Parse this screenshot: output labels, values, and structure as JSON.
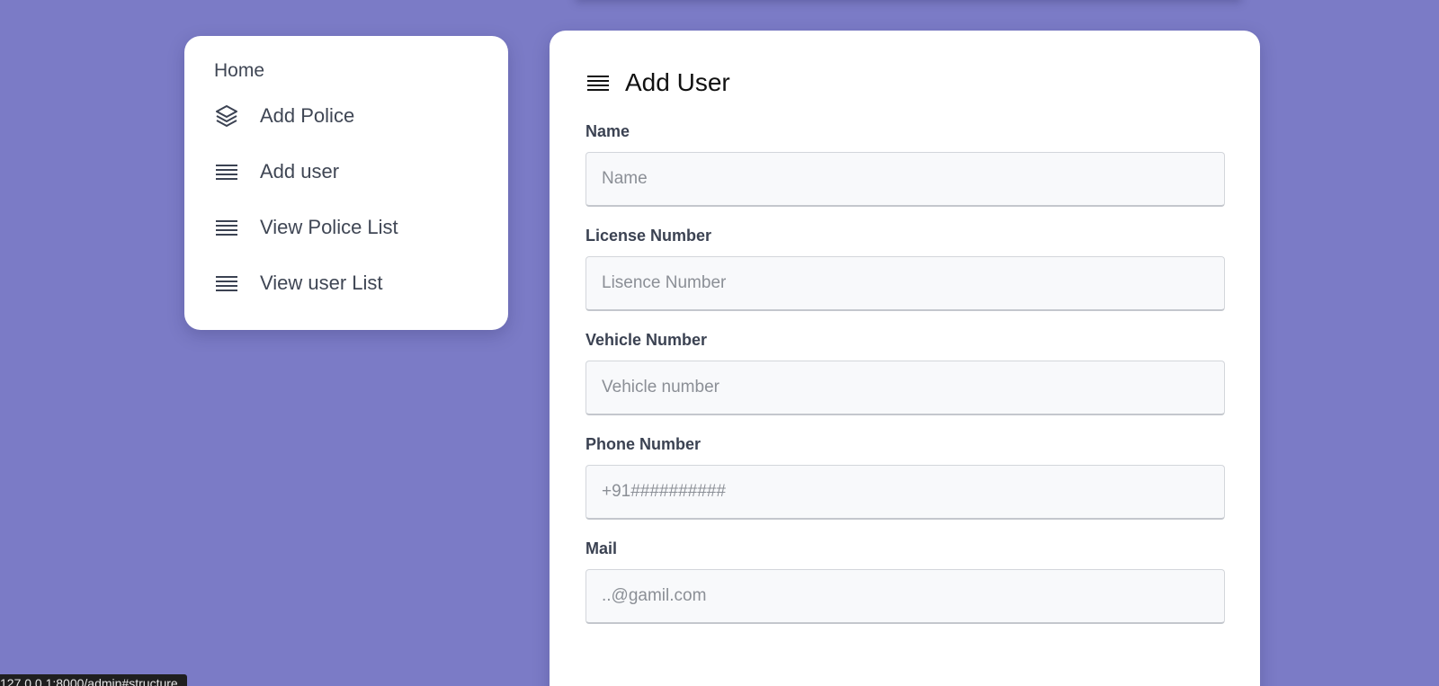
{
  "sidebar": {
    "home_label": "Home",
    "items": [
      {
        "label": "Add Police",
        "icon": "layers-icon"
      },
      {
        "label": "Add user",
        "icon": "list-icon"
      },
      {
        "label": "View Police List",
        "icon": "list-icon"
      },
      {
        "label": "View user List",
        "icon": "list-icon"
      }
    ]
  },
  "form": {
    "title": "Add User",
    "title_icon": "list-icon",
    "fields": [
      {
        "label": "Name",
        "placeholder": "Name",
        "value": ""
      },
      {
        "label": "License Number",
        "placeholder": "Lisence Number",
        "value": ""
      },
      {
        "label": "Vehicle Number",
        "placeholder": "Vehicle number",
        "value": ""
      },
      {
        "label": "Phone Number",
        "placeholder": "+91##########",
        "value": ""
      },
      {
        "label": "Mail",
        "placeholder": "..@gamil.com",
        "value": ""
      }
    ]
  },
  "status_bar": {
    "url": "127.0.0.1:8000/admin#structure"
  },
  "colors": {
    "background": "#7b7bc6",
    "card": "#ffffff",
    "input_bg": "#f8f9fb",
    "text": "#3f4654"
  }
}
